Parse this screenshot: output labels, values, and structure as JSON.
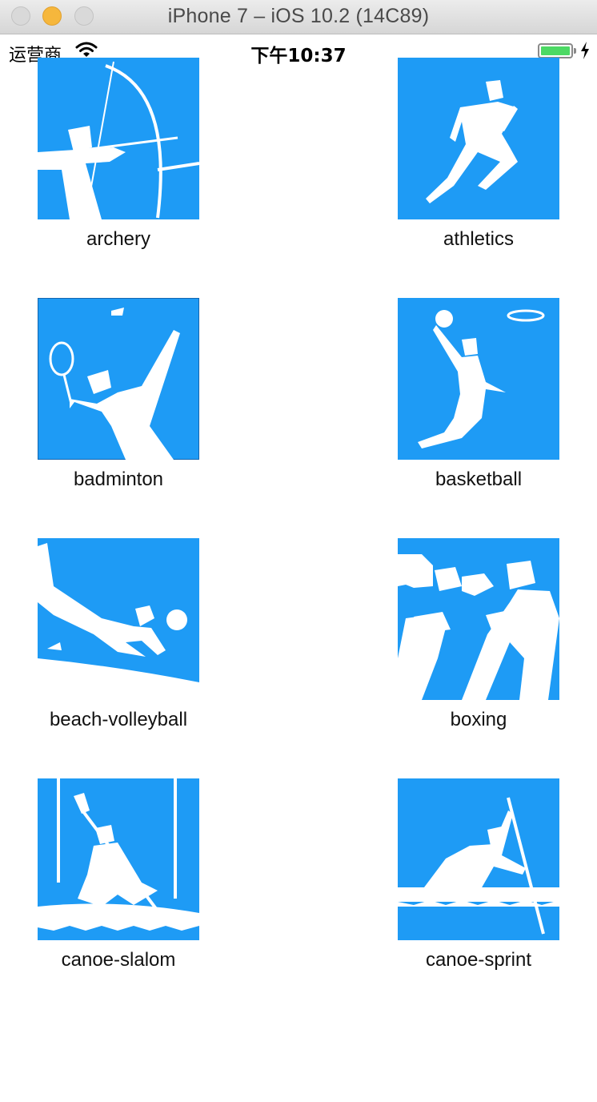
{
  "window": {
    "title": "iPhone 7 – iOS 10.2 (14C89)"
  },
  "status_bar": {
    "carrier": "运营商",
    "time": "下午10:37"
  },
  "sports": [
    {
      "label": "archery",
      "icon": "archery-pictogram-icon"
    },
    {
      "label": "athletics",
      "icon": "athletics-pictogram-icon"
    },
    {
      "label": "badminton",
      "icon": "badminton-pictogram-icon"
    },
    {
      "label": "basketball",
      "icon": "basketball-pictogram-icon"
    },
    {
      "label": "beach-volleyball",
      "icon": "beach-volleyball-pictogram-icon"
    },
    {
      "label": "boxing",
      "icon": "boxing-pictogram-icon"
    },
    {
      "label": "canoe-slalom",
      "icon": "canoe-slalom-pictogram-icon"
    },
    {
      "label": "canoe-sprint",
      "icon": "canoe-sprint-pictogram-icon"
    }
  ],
  "colors": {
    "tile": "#1e9bf5",
    "battery": "#4cd964"
  }
}
